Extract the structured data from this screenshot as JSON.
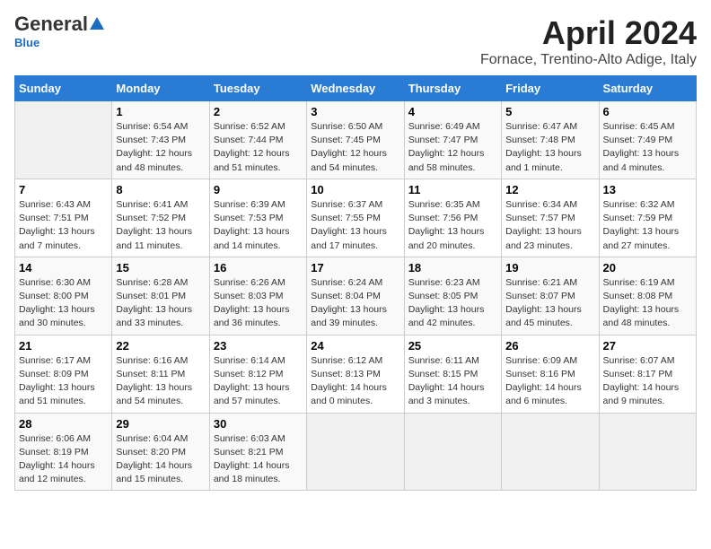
{
  "header": {
    "logo_general": "General",
    "logo_blue": "Blue",
    "title": "April 2024",
    "subtitle": "Fornace, Trentino-Alto Adige, Italy"
  },
  "days_of_week": [
    "Sunday",
    "Monday",
    "Tuesday",
    "Wednesday",
    "Thursday",
    "Friday",
    "Saturday"
  ],
  "weeks": [
    [
      {
        "day": null,
        "info": null
      },
      {
        "day": "1",
        "info": "Sunrise: 6:54 AM\nSunset: 7:43 PM\nDaylight: 12 hours\nand 48 minutes."
      },
      {
        "day": "2",
        "info": "Sunrise: 6:52 AM\nSunset: 7:44 PM\nDaylight: 12 hours\nand 51 minutes."
      },
      {
        "day": "3",
        "info": "Sunrise: 6:50 AM\nSunset: 7:45 PM\nDaylight: 12 hours\nand 54 minutes."
      },
      {
        "day": "4",
        "info": "Sunrise: 6:49 AM\nSunset: 7:47 PM\nDaylight: 12 hours\nand 58 minutes."
      },
      {
        "day": "5",
        "info": "Sunrise: 6:47 AM\nSunset: 7:48 PM\nDaylight: 13 hours\nand 1 minute."
      },
      {
        "day": "6",
        "info": "Sunrise: 6:45 AM\nSunset: 7:49 PM\nDaylight: 13 hours\nand 4 minutes."
      }
    ],
    [
      {
        "day": "7",
        "info": "Sunrise: 6:43 AM\nSunset: 7:51 PM\nDaylight: 13 hours\nand 7 minutes."
      },
      {
        "day": "8",
        "info": "Sunrise: 6:41 AM\nSunset: 7:52 PM\nDaylight: 13 hours\nand 11 minutes."
      },
      {
        "day": "9",
        "info": "Sunrise: 6:39 AM\nSunset: 7:53 PM\nDaylight: 13 hours\nand 14 minutes."
      },
      {
        "day": "10",
        "info": "Sunrise: 6:37 AM\nSunset: 7:55 PM\nDaylight: 13 hours\nand 17 minutes."
      },
      {
        "day": "11",
        "info": "Sunrise: 6:35 AM\nSunset: 7:56 PM\nDaylight: 13 hours\nand 20 minutes."
      },
      {
        "day": "12",
        "info": "Sunrise: 6:34 AM\nSunset: 7:57 PM\nDaylight: 13 hours\nand 23 minutes."
      },
      {
        "day": "13",
        "info": "Sunrise: 6:32 AM\nSunset: 7:59 PM\nDaylight: 13 hours\nand 27 minutes."
      }
    ],
    [
      {
        "day": "14",
        "info": "Sunrise: 6:30 AM\nSunset: 8:00 PM\nDaylight: 13 hours\nand 30 minutes."
      },
      {
        "day": "15",
        "info": "Sunrise: 6:28 AM\nSunset: 8:01 PM\nDaylight: 13 hours\nand 33 minutes."
      },
      {
        "day": "16",
        "info": "Sunrise: 6:26 AM\nSunset: 8:03 PM\nDaylight: 13 hours\nand 36 minutes."
      },
      {
        "day": "17",
        "info": "Sunrise: 6:24 AM\nSunset: 8:04 PM\nDaylight: 13 hours\nand 39 minutes."
      },
      {
        "day": "18",
        "info": "Sunrise: 6:23 AM\nSunset: 8:05 PM\nDaylight: 13 hours\nand 42 minutes."
      },
      {
        "day": "19",
        "info": "Sunrise: 6:21 AM\nSunset: 8:07 PM\nDaylight: 13 hours\nand 45 minutes."
      },
      {
        "day": "20",
        "info": "Sunrise: 6:19 AM\nSunset: 8:08 PM\nDaylight: 13 hours\nand 48 minutes."
      }
    ],
    [
      {
        "day": "21",
        "info": "Sunrise: 6:17 AM\nSunset: 8:09 PM\nDaylight: 13 hours\nand 51 minutes."
      },
      {
        "day": "22",
        "info": "Sunrise: 6:16 AM\nSunset: 8:11 PM\nDaylight: 13 hours\nand 54 minutes."
      },
      {
        "day": "23",
        "info": "Sunrise: 6:14 AM\nSunset: 8:12 PM\nDaylight: 13 hours\nand 57 minutes."
      },
      {
        "day": "24",
        "info": "Sunrise: 6:12 AM\nSunset: 8:13 PM\nDaylight: 14 hours\nand 0 minutes."
      },
      {
        "day": "25",
        "info": "Sunrise: 6:11 AM\nSunset: 8:15 PM\nDaylight: 14 hours\nand 3 minutes."
      },
      {
        "day": "26",
        "info": "Sunrise: 6:09 AM\nSunset: 8:16 PM\nDaylight: 14 hours\nand 6 minutes."
      },
      {
        "day": "27",
        "info": "Sunrise: 6:07 AM\nSunset: 8:17 PM\nDaylight: 14 hours\nand 9 minutes."
      }
    ],
    [
      {
        "day": "28",
        "info": "Sunrise: 6:06 AM\nSunset: 8:19 PM\nDaylight: 14 hours\nand 12 minutes."
      },
      {
        "day": "29",
        "info": "Sunrise: 6:04 AM\nSunset: 8:20 PM\nDaylight: 14 hours\nand 15 minutes."
      },
      {
        "day": "30",
        "info": "Sunrise: 6:03 AM\nSunset: 8:21 PM\nDaylight: 14 hours\nand 18 minutes."
      },
      {
        "day": null,
        "info": null
      },
      {
        "day": null,
        "info": null
      },
      {
        "day": null,
        "info": null
      },
      {
        "day": null,
        "info": null
      }
    ]
  ]
}
